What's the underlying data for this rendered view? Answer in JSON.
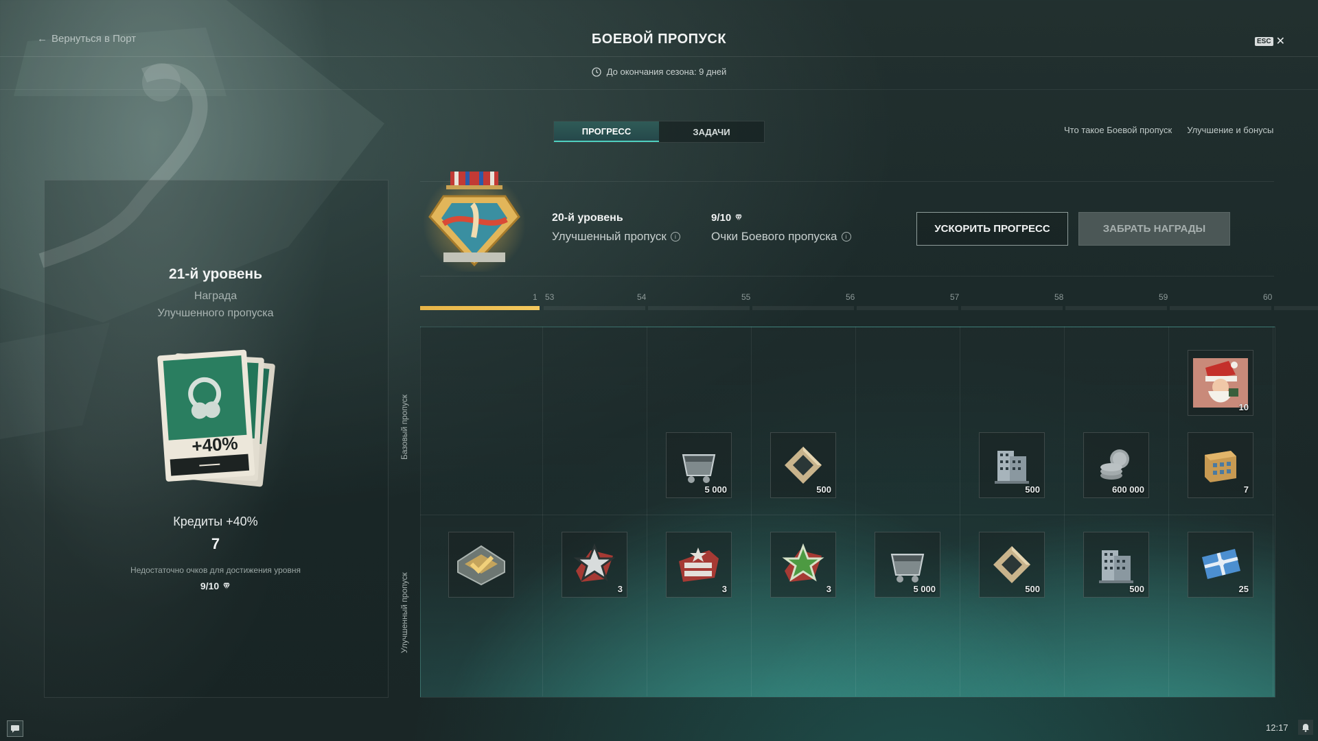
{
  "header": {
    "back_label": "Вернуться в Порт",
    "title": "БОЕВОЙ ПРОПУСК",
    "season_text": "До окончания сезона: 9 дней",
    "esc_label": "ESC",
    "close_symbol": "✕"
  },
  "tabs": [
    {
      "label": "ПРОГРЕСС",
      "active": true
    },
    {
      "label": "ЗАДАЧИ",
      "active": false
    }
  ],
  "help_links": [
    "Что такое Боевой пропуск",
    "Улучшение и бонусы"
  ],
  "summary": {
    "level": "20-й уровень",
    "pass_type": "Улучшенный пропуск",
    "points_value": "9/10",
    "points_label": "Очки Боевого пропуска",
    "boost_button": "УСКОРИТЬ ПРОГРЕСС",
    "claim_button": "ЗАБРАТЬ НАГРАДЫ"
  },
  "left_panel": {
    "level": "21-й уровень",
    "reward_line1": "Награда",
    "reward_line2": "Улучшенного пропуска",
    "card_text": "+40%",
    "reward_name": "Кредиты +40%",
    "count": "7",
    "note": "Недостаточно очков для достижения уровня",
    "points": "9/10"
  },
  "progress": {
    "current_label": "1",
    "level_labels": [
      "53",
      "54",
      "55",
      "56",
      "57",
      "58",
      "59",
      "60"
    ],
    "fill_fraction": 1.0
  },
  "rows": {
    "base_label": "Базовый пропуск",
    "premium_label": "Улучшенный пропуск"
  },
  "rewards": {
    "base_top": {
      "col": 7,
      "icon": "santa-container-icon",
      "qty": "10"
    },
    "base": [
      {
        "col": 2,
        "icon": "coal-cart-icon",
        "qty": "5 000"
      },
      {
        "col": 3,
        "icon": "steel-frame-icon",
        "qty": "500"
      },
      {
        "col": 5,
        "icon": "building-icon",
        "qty": "500"
      },
      {
        "col": 6,
        "icon": "credits-coins-icon",
        "qty": "600 000"
      },
      {
        "col": 7,
        "icon": "crate-icon",
        "qty": "7"
      }
    ],
    "premium": [
      {
        "col": 0,
        "icon": "checkmark-container-icon",
        "qty": ""
      },
      {
        "col": 1,
        "icon": "red-star-signal-icon",
        "qty": "3"
      },
      {
        "col": 2,
        "icon": "flag-star-signal-icon",
        "qty": "3"
      },
      {
        "col": 3,
        "icon": "green-star-signal-icon",
        "qty": "3"
      },
      {
        "col": 4,
        "icon": "coal-cart-icon",
        "qty": "5 000"
      },
      {
        "col": 5,
        "icon": "steel-frame-icon",
        "qty": "500"
      },
      {
        "col": 6,
        "icon": "building-icon",
        "qty": "500"
      },
      {
        "col": 7,
        "icon": "gift-ticket-icon",
        "qty": "25"
      }
    ]
  },
  "status": {
    "time": "12:17"
  },
  "colors": {
    "accent_teal": "#4fd0c0",
    "progress_gold": "#f4c95e"
  }
}
